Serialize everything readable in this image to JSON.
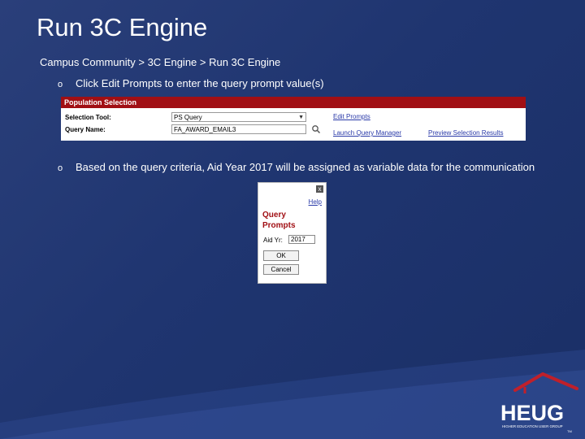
{
  "slide": {
    "title": "Run 3C Engine",
    "breadcrumb": "Campus Community > 3C Engine > Run 3C Engine",
    "bullets": [
      {
        "marker": "o",
        "text": "Click Edit Prompts to enter the query prompt value(s)"
      },
      {
        "marker": "o",
        "text": "Based on the query criteria, Aid Year 2017 will be assigned as variable data for the communication"
      }
    ]
  },
  "population_selection": {
    "header": "Population Selection",
    "selection_tool_label": "Selection Tool:",
    "selection_tool_value": "PS Query",
    "query_name_label": "Query Name:",
    "query_name_value": "FA_AWARD_EMAIL3",
    "edit_prompts_link": "Edit Prompts",
    "launch_query_manager_link": "Launch Query Manager",
    "preview_selection_results_link": "Preview Selection Results"
  },
  "query_prompts_dialog": {
    "close_glyph": "x",
    "help_link": "Help",
    "title": "Query Prompts",
    "aid_yr_label": "Aid Yr:",
    "aid_yr_value": "2017",
    "ok_label": "OK",
    "cancel_label": "Cancel"
  },
  "logo": {
    "text": "HEUG",
    "tagline": "HIGHER EDUCATION USER GROUP",
    "tm": "TM"
  },
  "colors": {
    "background": "#22397a",
    "accent_red": "#a10f14",
    "link_blue": "#2a3aa8"
  }
}
